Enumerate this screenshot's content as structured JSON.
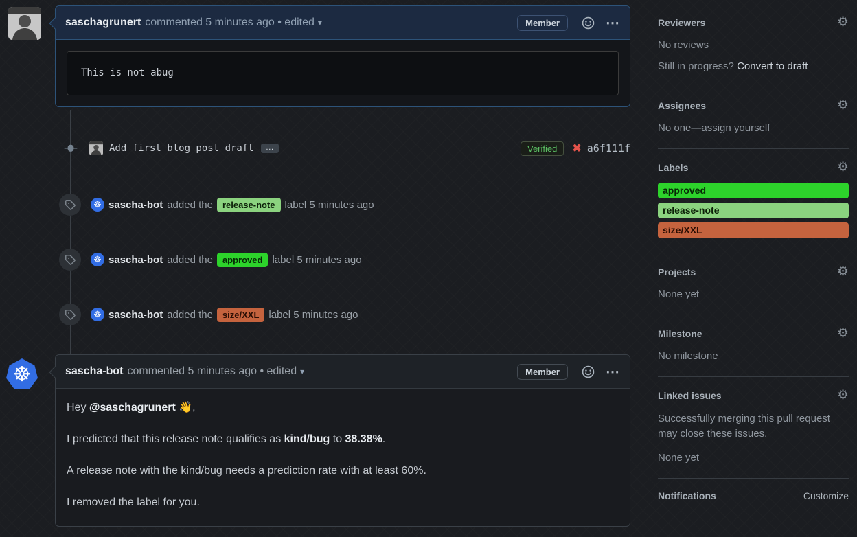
{
  "icons": {
    "kebab": "⋯",
    "caret_down": "▾",
    "gear": "⚙",
    "x_mark": "✖",
    "wheel": "☸",
    "commit_ellipsis": "…"
  },
  "comment1": {
    "author": "saschagrunert",
    "meta": "commented 5 minutes ago • edited",
    "badge": "Member",
    "code": "This is not abug"
  },
  "commit": {
    "message": "Add first blog post draft",
    "verified": "Verified",
    "hash": "a6f111f"
  },
  "events": [
    {
      "actor": "sascha-bot",
      "pre": "added the",
      "label": "release-note",
      "post": "label 5 minutes ago",
      "bg": "#8bd37f",
      "fg": "#0c2008"
    },
    {
      "actor": "sascha-bot",
      "pre": "added the",
      "label": "approved",
      "post": "label 5 minutes ago",
      "bg": "#2dd32b",
      "fg": "#062806"
    },
    {
      "actor": "sascha-bot",
      "pre": "added the",
      "label": "size/XXL",
      "post": "label 5 minutes ago",
      "bg": "#c5633e",
      "fg": "#2a0e04"
    }
  ],
  "comment2": {
    "author": "sascha-bot",
    "meta": "commented 5 minutes ago • edited",
    "badge": "Member",
    "p1_pre": "Hey ",
    "p1_mention": "@saschagrunert",
    "p1_post": " 👋,",
    "p2_a": "I predicted that this release note qualifies as ",
    "p2_b1": "kind/bug",
    "p2_c": " to ",
    "p2_b2": "38.38%",
    "p2_d": ".",
    "p3": "A release note with the kind/bug needs a prediction rate with at least 60%.",
    "p4": "I removed the label for you."
  },
  "sidebar": {
    "reviewers": {
      "title": "Reviewers",
      "empty": "No reviews",
      "hint": "Still in progress?",
      "hint_link": "Convert to draft"
    },
    "assignees": {
      "title": "Assignees",
      "empty": "No one—assign yourself"
    },
    "labels": {
      "title": "Labels",
      "items": [
        {
          "name": "approved",
          "bg": "#2dd32b",
          "fg": "#062806"
        },
        {
          "name": "release-note",
          "bg": "#8bd37f",
          "fg": "#0c2008"
        },
        {
          "name": "size/XXL",
          "bg": "#c5633e",
          "fg": "#2a0e04"
        }
      ]
    },
    "projects": {
      "title": "Projects",
      "empty": "None yet"
    },
    "milestone": {
      "title": "Milestone",
      "empty": "No milestone"
    },
    "linked_issues": {
      "title": "Linked issues",
      "desc": "Successfully merging this pull request may close these issues.",
      "empty": "None yet"
    },
    "notifications": {
      "title": "Notifications",
      "link": "Customize"
    }
  }
}
